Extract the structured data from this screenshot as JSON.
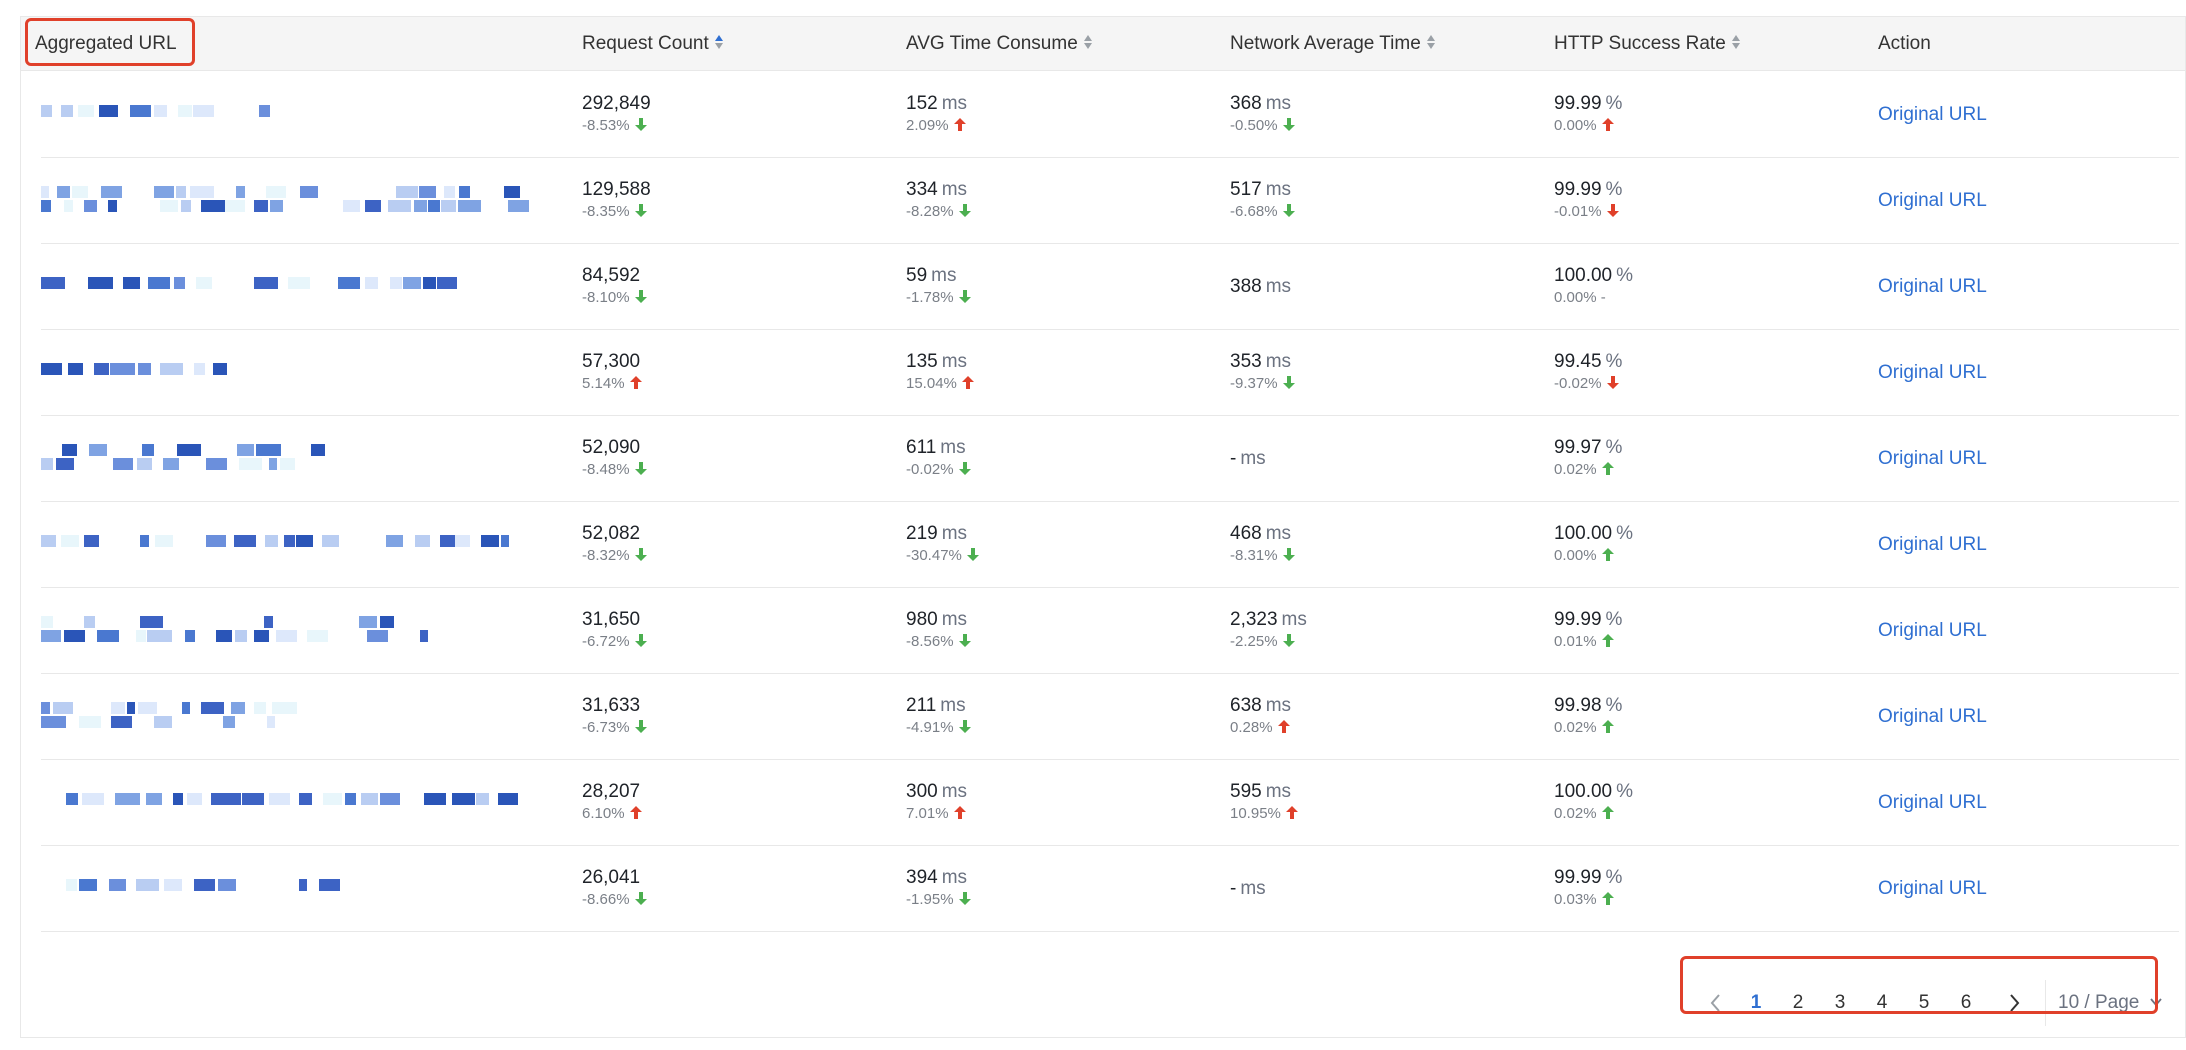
{
  "table": {
    "columns": [
      {
        "label": "Aggregated URL",
        "sortable": false
      },
      {
        "label": "Request Count",
        "sortable": true,
        "sort_state": "active"
      },
      {
        "label": "AVG Time Consume",
        "sortable": true
      },
      {
        "label": "Network Average Time",
        "sortable": true
      },
      {
        "label": "HTTP Success Rate",
        "sortable": true
      },
      {
        "label": "Action",
        "sortable": false
      }
    ],
    "units": {
      "time": "ms",
      "rate": "%"
    },
    "rows": [
      {
        "requests": "292,849",
        "requests_delta": "-8.53%",
        "requests_trend": "down",
        "avg_time": "152",
        "avg_time_delta": "2.09%",
        "avg_time_trend": "up",
        "net_time": "368",
        "net_time_delta": "-0.50%",
        "net_time_trend": "down",
        "success": "99.99",
        "success_delta": "0.00%",
        "success_trend": "up",
        "action": "Original URL"
      },
      {
        "requests": "129,588",
        "requests_delta": "-8.35%",
        "requests_trend": "down",
        "avg_time": "334",
        "avg_time_delta": "-8.28%",
        "avg_time_trend": "down",
        "net_time": "517",
        "net_time_delta": "-6.68%",
        "net_time_trend": "down",
        "success": "99.99",
        "success_delta": "-0.01%",
        "success_trend": "up-red",
        "action": "Original URL"
      },
      {
        "requests": "84,592",
        "requests_delta": "-8.10%",
        "requests_trend": "down",
        "avg_time": "59",
        "avg_time_delta": "-1.78%",
        "avg_time_trend": "down",
        "net_time": "388",
        "net_time_delta": "",
        "net_time_trend": "none",
        "success": "100.00",
        "success_delta": "0.00%",
        "success_trend": "dash",
        "action": "Original URL"
      },
      {
        "requests": "57,300",
        "requests_delta": "5.14%",
        "requests_trend": "up",
        "avg_time": "135",
        "avg_time_delta": "15.04%",
        "avg_time_trend": "up",
        "net_time": "353",
        "net_time_delta": "-9.37%",
        "net_time_trend": "down",
        "success": "99.45",
        "success_delta": "-0.02%",
        "success_trend": "up-red",
        "action": "Original URL"
      },
      {
        "requests": "52,090",
        "requests_delta": "-8.48%",
        "requests_trend": "down",
        "avg_time": "611",
        "avg_time_delta": "-0.02%",
        "avg_time_trend": "down",
        "net_time": "-",
        "net_time_delta": "",
        "net_time_trend": "none",
        "success": "99.97",
        "success_delta": "0.02%",
        "success_trend": "up-green",
        "action": "Original URL"
      },
      {
        "requests": "52,082",
        "requests_delta": "-8.32%",
        "requests_trend": "down",
        "avg_time": "219",
        "avg_time_delta": "-30.47%",
        "avg_time_trend": "down",
        "net_time": "468",
        "net_time_delta": "-8.31%",
        "net_time_trend": "down",
        "success": "100.00",
        "success_delta": "0.00%",
        "success_trend": "up-green",
        "action": "Original URL"
      },
      {
        "requests": "31,650",
        "requests_delta": "-6.72%",
        "requests_trend": "down",
        "avg_time": "980",
        "avg_time_delta": "-8.56%",
        "avg_time_trend": "down",
        "net_time": "2,323",
        "net_time_delta": "-2.25%",
        "net_time_trend": "down",
        "success": "99.99",
        "success_delta": "0.01%",
        "success_trend": "up-green",
        "action": "Original URL"
      },
      {
        "requests": "31,633",
        "requests_delta": "-6.73%",
        "requests_trend": "down",
        "avg_time": "211",
        "avg_time_delta": "-4.91%",
        "avg_time_trend": "down",
        "net_time": "638",
        "net_time_delta": "0.28%",
        "net_time_trend": "up",
        "success": "99.98",
        "success_delta": "0.02%",
        "success_trend": "up-green",
        "action": "Original URL"
      },
      {
        "requests": "28,207",
        "requests_delta": "6.10%",
        "requests_trend": "up",
        "avg_time": "300",
        "avg_time_delta": "7.01%",
        "avg_time_trend": "up",
        "net_time": "595",
        "net_time_delta": "10.95%",
        "net_time_trend": "up",
        "success": "100.00",
        "success_delta": "0.02%",
        "success_trend": "up-green",
        "action": "Original URL"
      },
      {
        "requests": "26,041",
        "requests_delta": "-8.66%",
        "requests_trend": "down",
        "avg_time": "394",
        "avg_time_delta": "-1.95%",
        "avg_time_trend": "down",
        "net_time": "-",
        "net_time_delta": "",
        "net_time_trend": "none",
        "success": "99.99",
        "success_delta": "0.03%",
        "success_trend": "up-green",
        "action": "Original URL"
      }
    ]
  },
  "pagination": {
    "pages": [
      "1",
      "2",
      "3",
      "4",
      "5",
      "6"
    ],
    "current": "1",
    "page_size": "10 / Page",
    "prev_icon": "chevron-left-icon",
    "next_icon": "chevron-right-icon"
  },
  "colors": {
    "accent": "#2f6fd1",
    "up_trend": "#e0402a",
    "down_trend": "#4caf50",
    "highlight": "#e0402a"
  }
}
